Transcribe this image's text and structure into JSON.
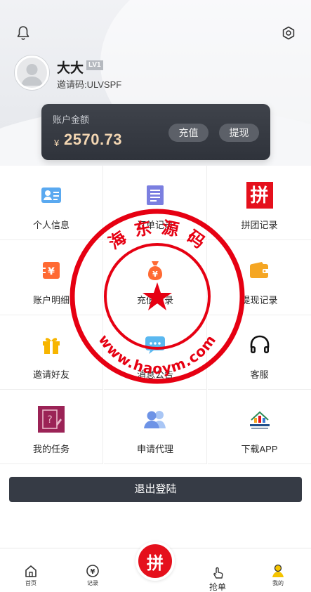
{
  "header": {
    "username": "大大",
    "level": "LV1",
    "invite_code": "邀请码:ULVSPF"
  },
  "balance": {
    "label": "账户金额",
    "currency": "¥",
    "amount": "2570.73",
    "recharge_label": "充值",
    "withdraw_label": "提现"
  },
  "menu": [
    {
      "label": "个人信息",
      "icon": "id-card-icon"
    },
    {
      "label": "订单记录",
      "icon": "order-list-icon"
    },
    {
      "label": "拼团记录",
      "icon": "group-buy-icon"
    },
    {
      "label": "账户明细",
      "icon": "account-detail-icon"
    },
    {
      "label": "充值记录",
      "icon": "money-bag-icon"
    },
    {
      "label": "提现记录",
      "icon": "wallet-icon"
    },
    {
      "label": "邀请好友",
      "icon": "gift-icon"
    },
    {
      "label": "消息公告",
      "icon": "message-icon"
    },
    {
      "label": "客服",
      "icon": "headphones-icon"
    },
    {
      "label": "我的任务",
      "icon": "task-icon"
    },
    {
      "label": "申请代理",
      "icon": "agent-icon"
    },
    {
      "label": "下载APP",
      "icon": "app-logo-icon"
    }
  ],
  "logout_label": "退出登陆",
  "tabbar": {
    "home": "首页",
    "records": "记录",
    "center": "拼",
    "grab": "抢单",
    "mine": "我的"
  },
  "watermark": {
    "top_text": "海 东 源 码",
    "bottom_text": "www.haoym.com"
  },
  "colors": {
    "accent_red": "#e5101c",
    "card_dark": "#363b45",
    "balance_gold": "#f3d6b2"
  }
}
